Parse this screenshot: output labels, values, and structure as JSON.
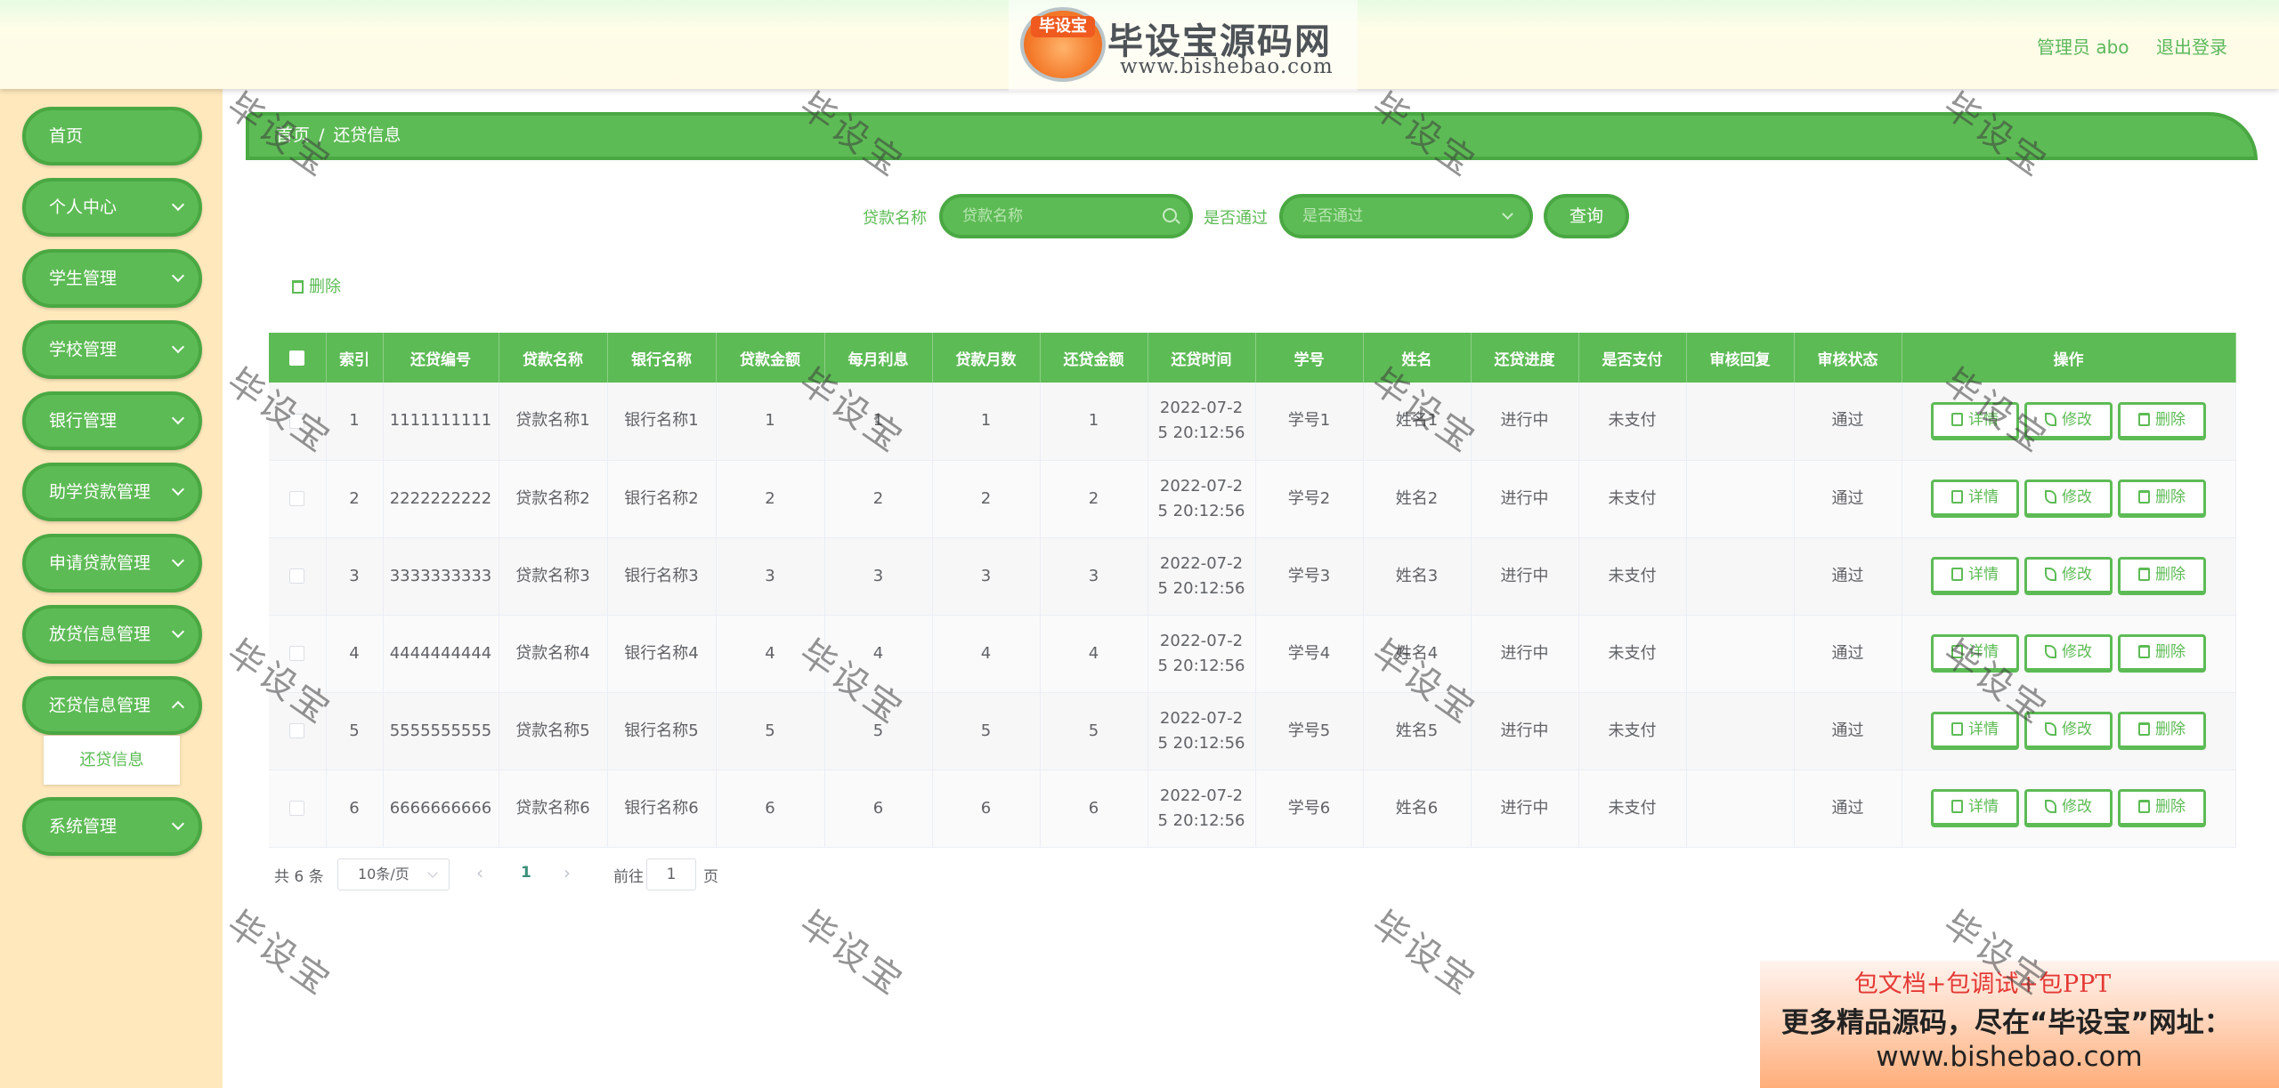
{
  "header": {
    "logo_badge": "毕设宝",
    "logo_title": "毕设宝源码网",
    "logo_url": "www.bishebao.com",
    "user_label": "管理员 abo",
    "logout_label": "退出登录"
  },
  "sidebar": {
    "items": [
      {
        "label": "首页"
      },
      {
        "label": "个人中心"
      },
      {
        "label": "学生管理"
      },
      {
        "label": "学校管理"
      },
      {
        "label": "银行管理"
      },
      {
        "label": "助学贷款管理"
      },
      {
        "label": "申请贷款管理"
      },
      {
        "label": "放贷信息管理"
      },
      {
        "label": "还贷信息管理"
      },
      {
        "label": "系统管理"
      }
    ],
    "sub_item": "还贷信息"
  },
  "breadcrumb": {
    "home": "首页",
    "sep": "/",
    "current": "还贷信息"
  },
  "search": {
    "name_label": "贷款名称",
    "name_placeholder": "贷款名称",
    "pass_label": "是否通过",
    "pass_placeholder": "是否通过",
    "query_label": "查询"
  },
  "toolbar": {
    "delete_label": "删除"
  },
  "table": {
    "headers": [
      "索引",
      "还贷编号",
      "贷款名称",
      "银行名称",
      "贷款金额",
      "每月利息",
      "贷款月数",
      "还贷金额",
      "还贷时间",
      "学号",
      "姓名",
      "还贷进度",
      "是否支付",
      "审核回复",
      "审核状态",
      "操作"
    ],
    "rows": [
      {
        "idx": "1",
        "code": "1111111111",
        "loan": "贷款名称1",
        "bank": "银行名称1",
        "amount": "1",
        "interest": "1",
        "months": "1",
        "repay": "1",
        "time1": "2022-07-2",
        "time2": "5 20:12:56",
        "sno": "学号1",
        "name": "姓名1",
        "progress": "进行中",
        "paid": "未支付",
        "reply": "",
        "status": "通过"
      },
      {
        "idx": "2",
        "code": "2222222222",
        "loan": "贷款名称2",
        "bank": "银行名称2",
        "amount": "2",
        "interest": "2",
        "months": "2",
        "repay": "2",
        "time1": "2022-07-2",
        "time2": "5 20:12:56",
        "sno": "学号2",
        "name": "姓名2",
        "progress": "进行中",
        "paid": "未支付",
        "reply": "",
        "status": "通过"
      },
      {
        "idx": "3",
        "code": "3333333333",
        "loan": "贷款名称3",
        "bank": "银行名称3",
        "amount": "3",
        "interest": "3",
        "months": "3",
        "repay": "3",
        "time1": "2022-07-2",
        "time2": "5 20:12:56",
        "sno": "学号3",
        "name": "姓名3",
        "progress": "进行中",
        "paid": "未支付",
        "reply": "",
        "status": "通过"
      },
      {
        "idx": "4",
        "code": "4444444444",
        "loan": "贷款名称4",
        "bank": "银行名称4",
        "amount": "4",
        "interest": "4",
        "months": "4",
        "repay": "4",
        "time1": "2022-07-2",
        "time2": "5 20:12:56",
        "sno": "学号4",
        "name": "姓名4",
        "progress": "进行中",
        "paid": "未支付",
        "reply": "",
        "status": "通过"
      },
      {
        "idx": "5",
        "code": "5555555555",
        "loan": "贷款名称5",
        "bank": "银行名称5",
        "amount": "5",
        "interest": "5",
        "months": "5",
        "repay": "5",
        "time1": "2022-07-2",
        "time2": "5 20:12:56",
        "sno": "学号5",
        "name": "姓名5",
        "progress": "进行中",
        "paid": "未支付",
        "reply": "",
        "status": "通过"
      },
      {
        "idx": "6",
        "code": "6666666666",
        "loan": "贷款名称6",
        "bank": "银行名称6",
        "amount": "6",
        "interest": "6",
        "months": "6",
        "repay": "6",
        "time1": "2022-07-2",
        "time2": "5 20:12:56",
        "sno": "学号6",
        "name": "姓名6",
        "progress": "进行中",
        "paid": "未支付",
        "reply": "",
        "status": "通过"
      }
    ],
    "actions": {
      "detail": "详情",
      "edit": "修改",
      "delete": "删除"
    }
  },
  "pagination": {
    "total": "共 6 条",
    "page_size": "10条/页",
    "prev": "‹",
    "current_page": "1",
    "next": "›",
    "goto_label": "前往",
    "goto_value": "1",
    "goto_unit": "页"
  },
  "watermark": "毕设宝",
  "ad": {
    "line1": "包文档+包调试+包PPT",
    "line2": "更多精品源码，尽在“毕设宝”网址：",
    "line3": "www.bishebao.com"
  },
  "colors": {
    "accent": "#5dbb55",
    "accent_dark": "#4aa843",
    "sidebar_bg": "#fee8bc"
  },
  "icons": {
    "search": "search-icon",
    "chevron": "chevron-down-icon",
    "trash": "trash-icon",
    "doc": "document-icon",
    "edit": "edit-icon"
  }
}
